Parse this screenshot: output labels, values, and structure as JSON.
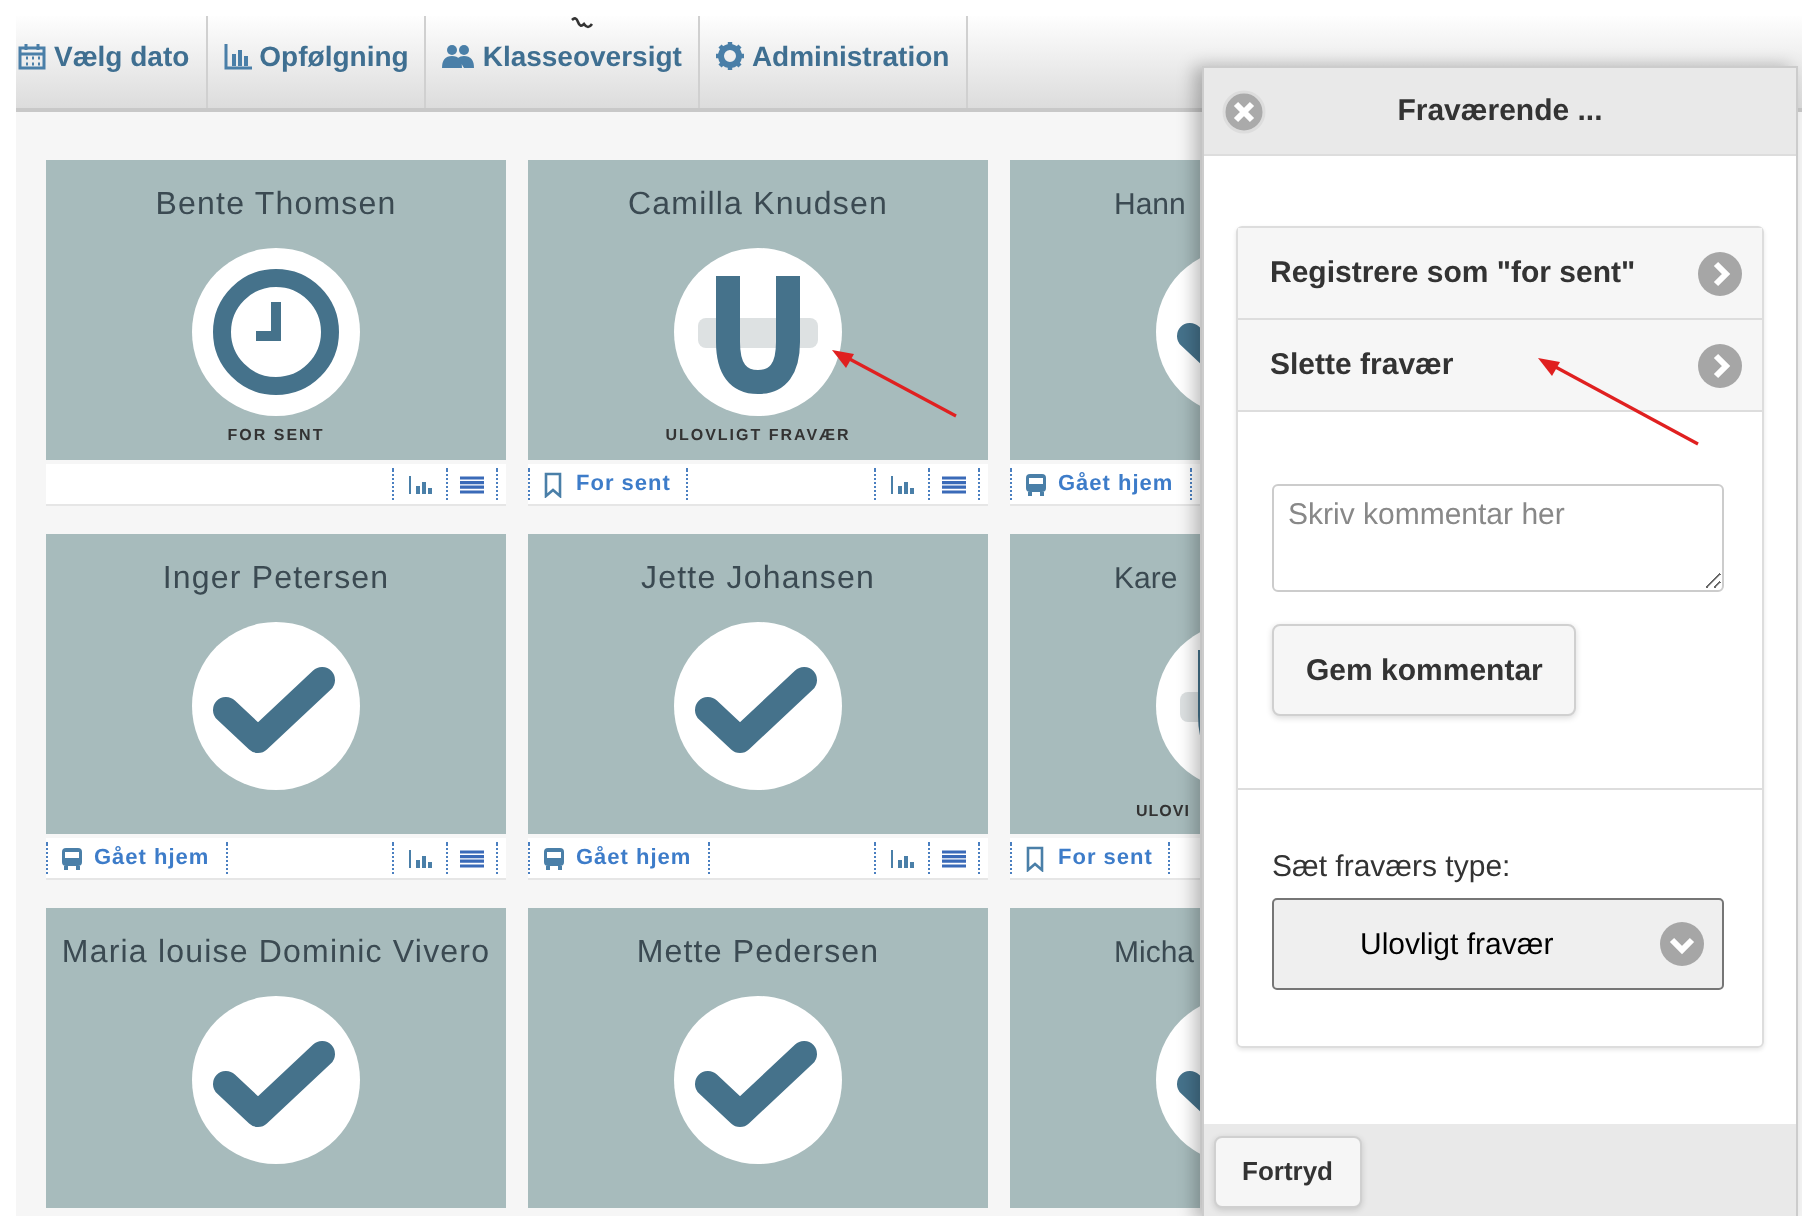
{
  "nav": [
    {
      "kind": "calendar",
      "label": "Vælg dato"
    },
    {
      "kind": "chart",
      "label": "Opfølgning"
    },
    {
      "kind": "users",
      "label": "Klasseoversigt"
    },
    {
      "kind": "gear",
      "label": "Administration"
    }
  ],
  "rows": [
    {
      "cards": [
        {
          "name": "Bente Thomsen",
          "kind": "late",
          "status_label": "FOR SENT"
        },
        {
          "name": "Camilla Knudsen",
          "kind": "absent",
          "status_label": "ULOVLIGT FRAVÆR",
          "tag": {
            "kind": "bookmark",
            "label": "For sent"
          }
        },
        {
          "name": "Hann",
          "kind": "present",
          "tag": {
            "kind": "bus",
            "label": "Gået hjem"
          }
        }
      ]
    },
    {
      "cards": [
        {
          "name": "Inger Petersen",
          "kind": "present",
          "tag": {
            "kind": "bus",
            "label": "Gået hjem"
          }
        },
        {
          "name": "Jette Johansen",
          "kind": "present",
          "tag": {
            "kind": "bus",
            "label": "Gået hjem"
          }
        },
        {
          "name": "Kare",
          "kind": "absent",
          "status_label": "ULOVI",
          "tag": {
            "kind": "bookmark",
            "label": "For sent"
          }
        }
      ]
    },
    {
      "cards": [
        {
          "name": "Maria louise Dominic Vivero",
          "kind": "present"
        },
        {
          "name": "Mette Pedersen",
          "kind": "present"
        },
        {
          "name": "Micha",
          "kind": "present"
        }
      ]
    }
  ],
  "panel": {
    "title": "Fraværende ...",
    "actions": [
      {
        "label": "Registrere som \"for sent\""
      },
      {
        "label": "Slette fravær"
      }
    ],
    "comment": {
      "placeholder": "Skriv kommentar her"
    },
    "save_button": "Gem kommentar",
    "type_label": "Sæt fraværs type:",
    "type_select": {
      "value": "Ulovligt fravær"
    },
    "cancel_button": "Fortryd"
  }
}
